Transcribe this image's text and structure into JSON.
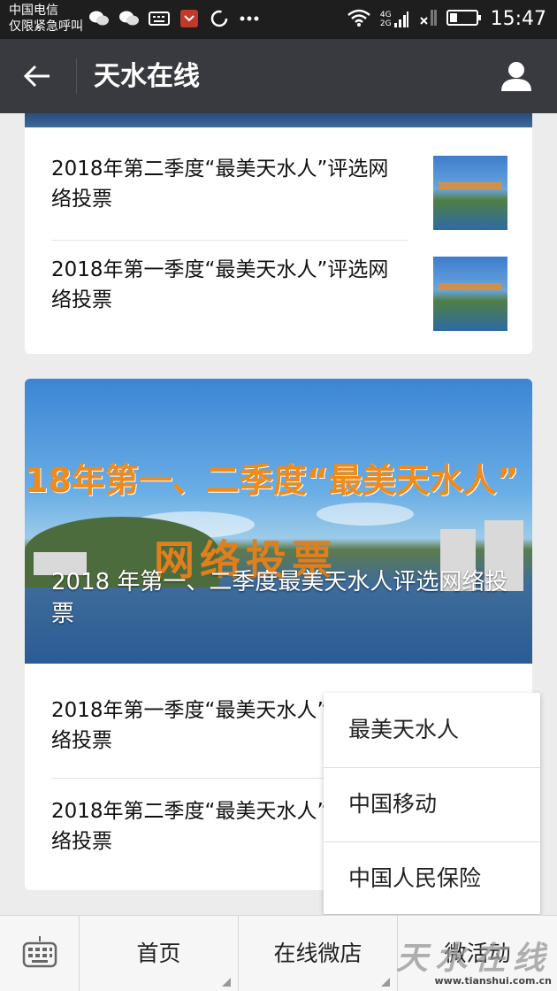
{
  "status_bar": {
    "carrier": "中国电信",
    "carrier_note": "仅限紧急呼叫",
    "network": "4G",
    "network2": "2G",
    "time": "15:47"
  },
  "header": {
    "title": "天水在线"
  },
  "top_card": {
    "articles": [
      {
        "title": "2018年第二季度“最美天水人”评选网络投票"
      },
      {
        "title": "2018年第一季度“最美天水人”评选网络投票"
      }
    ]
  },
  "bottom_card": {
    "hero": {
      "banner_line1": "18年第一、二季度“最美天水人”",
      "banner_line2": "网络投票",
      "caption": "2018 年第一、二季度最美天水人评选网络投票"
    },
    "articles": [
      {
        "title": "2018年第一季度“最美天水人”评选网络投票"
      },
      {
        "title": "2018年第二季度“最美天水人”评选网络投票"
      }
    ]
  },
  "popup_menu": {
    "items": [
      "最美天水人",
      "中国移动",
      "中国人民保险"
    ]
  },
  "bottom_menu": {
    "tabs": [
      "首页",
      "在线微店",
      "微活动"
    ]
  },
  "watermark": {
    "text": "天水在线",
    "url": "www.tianshui.com.cn"
  },
  "colors": {
    "title_bar": "#393a3f",
    "status_bar": "#1e1e1e",
    "banner_orange": "#f08a18"
  }
}
